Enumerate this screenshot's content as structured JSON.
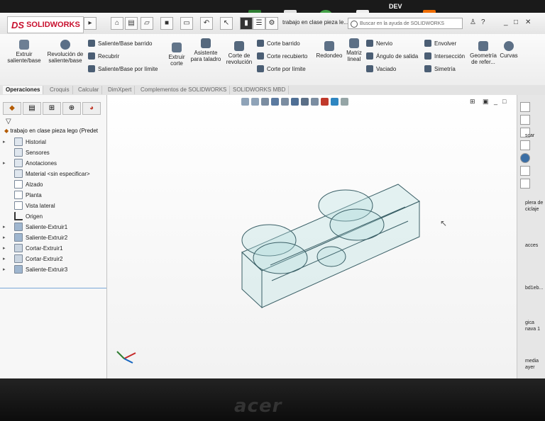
{
  "app": {
    "brand": "SOLIDWORKS",
    "logo_prefix": "DS",
    "document_title": "trabajo en clase pieza le...",
    "search_placeholder": "Buscar en la ayuda de SOLIDWORKS",
    "help_glyph": "?",
    "laptop_brand": "acer"
  },
  "desktop": {
    "top_label": "DEV",
    "side_labels": [
      "scar",
      "plera de",
      "ciclaje",
      "acces",
      "bd1eb...",
      "gica",
      "nava 1",
      "media",
      "ayer"
    ]
  },
  "ribbon": {
    "extruir_saliente": "Extruir saliente/base",
    "revolucion": "Revolución de saliente/base",
    "barrido": "Saliente/Base barrido",
    "recubrir": "Recubrir",
    "limite": "Saliente/Base por límite",
    "extruir_corte": "Extruir corte",
    "asistente": "Asistente para taladro",
    "corte_revolucion": "Corte de revolución",
    "corte_barrido": "Corte barrido",
    "corte_recubierto": "Corte recubierto",
    "corte_limite": "Corte por límite",
    "redondeo": "Redondeo",
    "matriz": "Matriz lineal",
    "nervio": "Nervio",
    "angulo": "Ángulo de salida",
    "vaciado": "Vaciado",
    "envolver": "Envolver",
    "interseccion": "Intersección",
    "simetria": "Simetría",
    "geometria": "Geometría de refer...",
    "curvas": "Curvas"
  },
  "tabs": [
    "Operaciones",
    "Croquis",
    "Calcular",
    "DimXpert",
    "Complementos de SOLIDWORKS",
    "SOLIDWORKS MBD"
  ],
  "tree": {
    "root": "trabajo en clase pieza lego  (Predet",
    "items": [
      "Historial",
      "Sensores",
      "Anotaciones",
      "Material <sin especificar>",
      "Alzado",
      "Planta",
      "Vista lateral",
      "Origen",
      "Saliente-Extruir1",
      "Saliente-Extruir2",
      "Cortar-Extruir1",
      "Cortar-Extruir2",
      "Saliente-Extruir3"
    ]
  },
  "colors": {
    "brand_red": "#c8102e",
    "model_fill": "#b8dfe0",
    "model_edge": "#3a5f66"
  }
}
